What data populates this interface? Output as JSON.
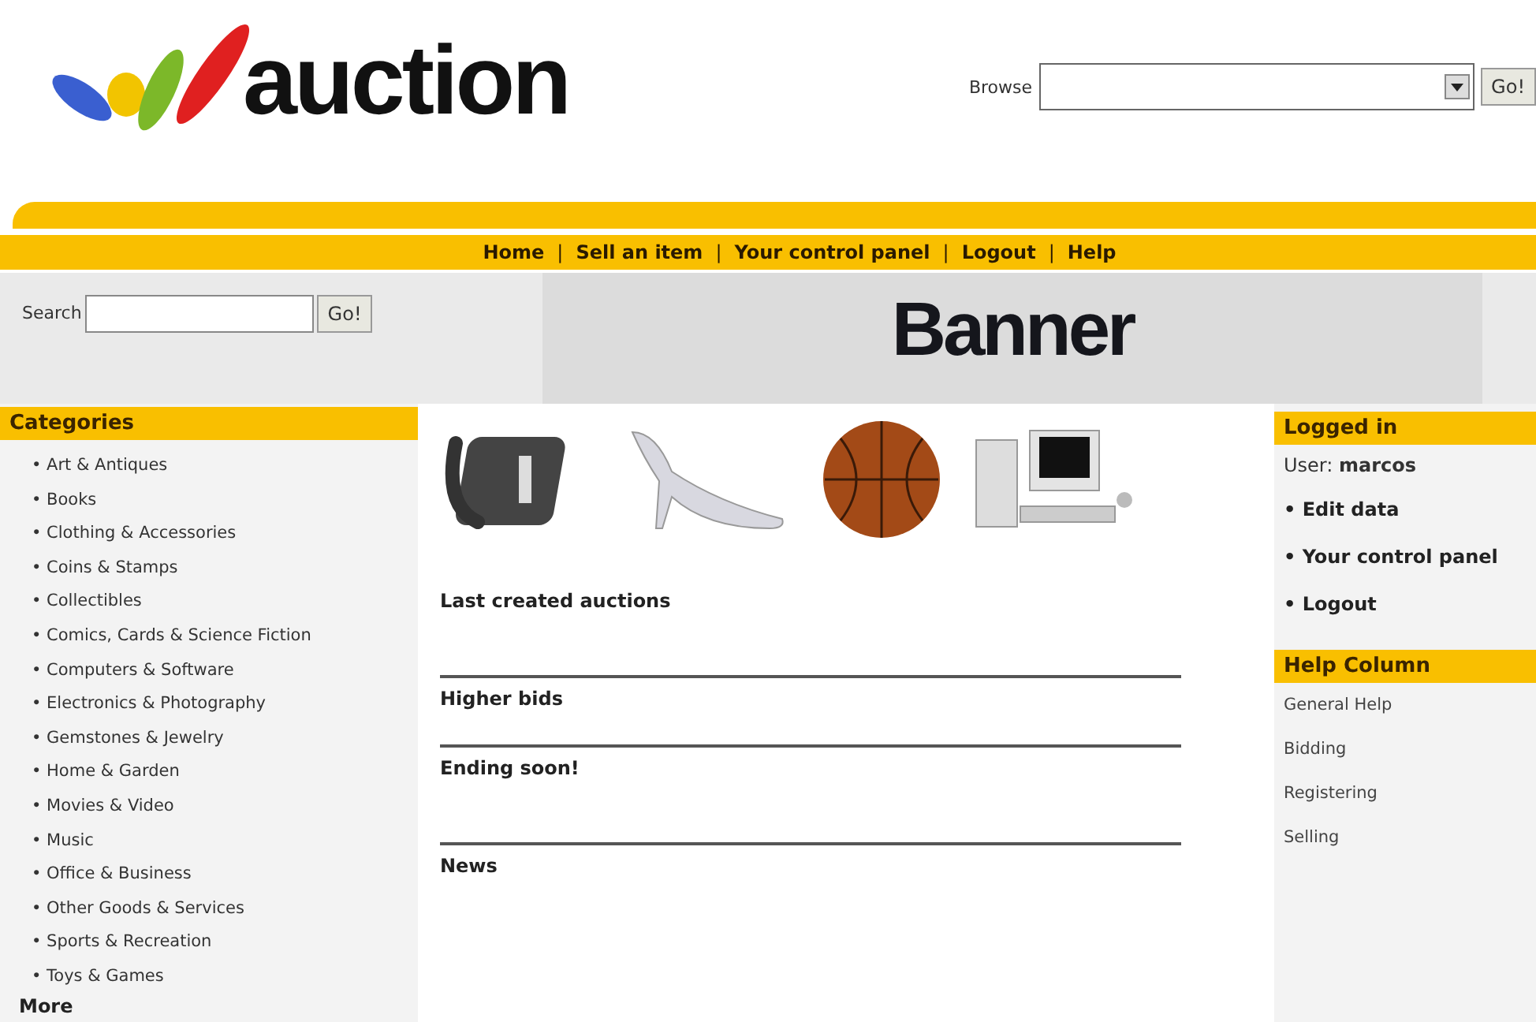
{
  "header": {
    "logo_text": "auction",
    "browse": {
      "label": "Browse",
      "button": "Go!"
    }
  },
  "nav": {
    "items": [
      "Home",
      "Sell an item",
      "Your control panel",
      "Logout",
      "Help"
    ],
    "separator": "|"
  },
  "search": {
    "label": "Search",
    "button": "Go!"
  },
  "banner": {
    "title": "Banner"
  },
  "categories": {
    "title": "Categories",
    "items": [
      "• Art & Antiques",
      "• Books",
      "• Clothing & Accessories",
      "• Coins & Stamps",
      "• Collectibles",
      "• Comics, Cards & Science Fiction",
      "• Computers & Software",
      "• Electronics & Photography",
      "• Gemstones & Jewelry",
      "• Home & Garden",
      "• Movies & Video",
      "• Music",
      "• Office & Business",
      "• Other Goods & Services",
      "• Sports & Recreation",
      "• Toys & Games"
    ],
    "more": "More"
  },
  "main": {
    "sections": [
      "Last created auctions",
      "Higher bids",
      "Ending soon!",
      "News"
    ]
  },
  "logged_in": {
    "title": "Logged in",
    "user_label": "User:",
    "user": "marcos",
    "links": [
      "• Edit data",
      "• Your control panel",
      "• Logout"
    ]
  },
  "help": {
    "title": "Help Column",
    "links": [
      "General Help",
      "Bidding",
      "Registering",
      "Selling"
    ]
  }
}
